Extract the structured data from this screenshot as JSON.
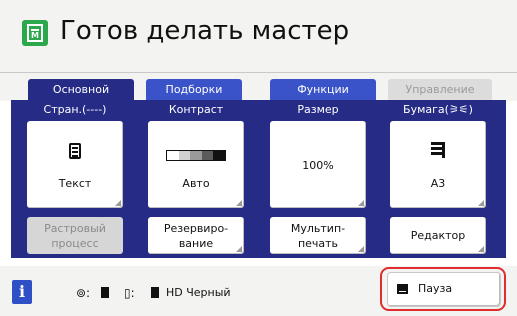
{
  "header": {
    "title": "Готов делать мастер"
  },
  "tabs": [
    {
      "label": "Основной"
    },
    {
      "label": "Подборки"
    },
    {
      "label": "Функции"
    },
    {
      "label": "Управление"
    }
  ],
  "columns": [
    {
      "label": "Стран.(----)"
    },
    {
      "label": "Контраст"
    },
    {
      "label": "Размер"
    },
    {
      "label": "Бумага(⚞⚟)"
    }
  ],
  "tiles": {
    "mode": {
      "value": "Текст"
    },
    "contrast": {
      "value": "Авто",
      "level_steps": 5
    },
    "size": {
      "value": "100%"
    },
    "paper": {
      "value": "A3"
    }
  },
  "functions": [
    {
      "line1": "Растровый",
      "line2": "процесс"
    },
    {
      "line1": "Резервиро-",
      "line2": "вание"
    },
    {
      "line1": "Мультип-",
      "line2": "печать"
    },
    {
      "line1": "Редактор"
    }
  ],
  "status": {
    "ink_label": "HD Черный",
    "pause_label": "Пауза",
    "info_label": "i"
  },
  "colors": {
    "active_tab": "#262b86",
    "tab": "#3a53c8",
    "highlight_ring": "#e02c2c",
    "info_button": "#2e4fc5",
    "master_icon": "#2aa84b"
  },
  "icons": {
    "header": "master-making-icon",
    "mode": "text-document-icon",
    "contrast": "contrast-scale-icon",
    "paper": "paper-size-icon",
    "pause": "pause-icon",
    "master_status": "master-roll-icon",
    "ink_status": "ink-cartridge-icon"
  }
}
